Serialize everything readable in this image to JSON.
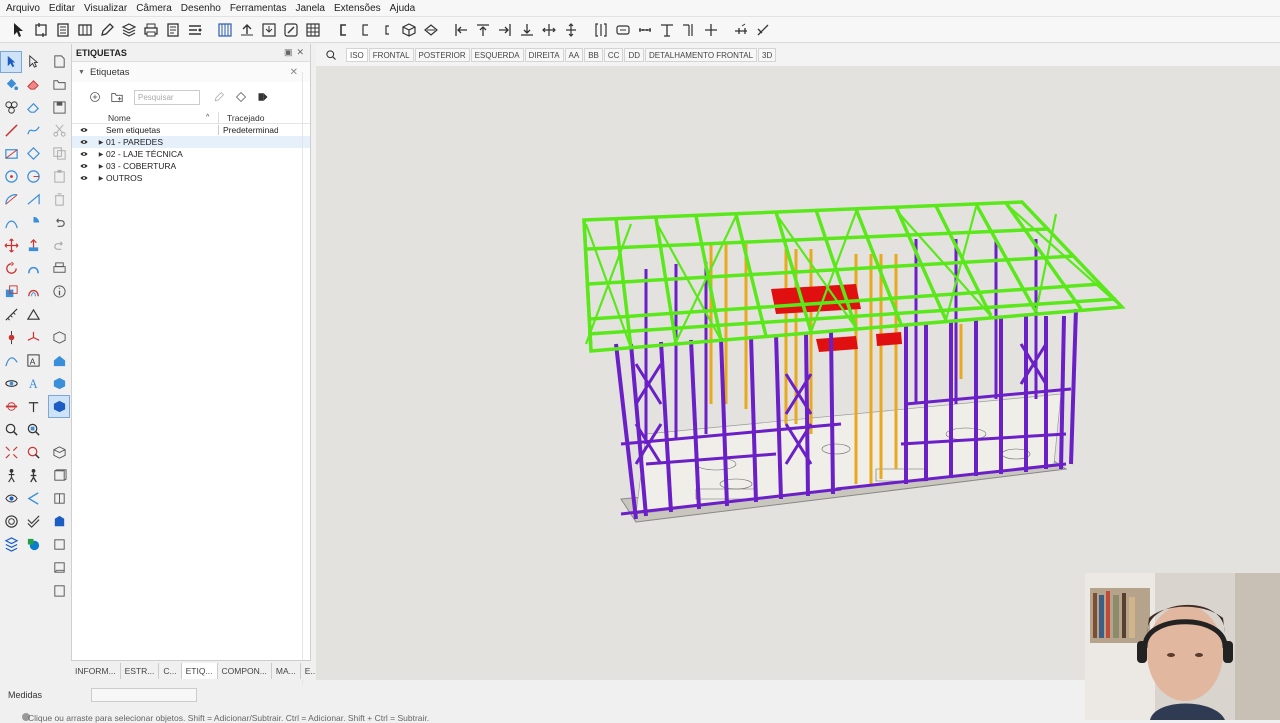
{
  "menu": [
    "Arquivo",
    "Editar",
    "Visualizar",
    "Câmera",
    "Desenho",
    "Ferramentas",
    "Janela",
    "Extensões",
    "Ajuda"
  ],
  "toolbar_icons": [
    "select-icon",
    "component-icon",
    "report-icon",
    "table-icon",
    "edit-icon",
    "layers-icon",
    "print-icon",
    "list-icon",
    "align-icon",
    "columns-icon",
    "upload-icon",
    "pencil-icon",
    "grid-icon",
    "c-profile-icon",
    "c-profile-icon",
    "c-profile-icon",
    "box-icon",
    "paint-icon",
    "align-left-icon",
    "align-top-icon",
    "align-right-icon",
    "align-bottom-icon",
    "center-h-icon",
    "center-v-icon",
    "split-icon",
    "dimension-icon",
    "ruler-icon",
    "stud-icon",
    "connector-icon",
    "cross-icon",
    "beam-icon",
    "angle-icon"
  ],
  "panel": {
    "title": "ETIQUETAS",
    "section": "Etiquetas",
    "search_placeholder": "Pesquisar",
    "columns": {
      "name": "Nome",
      "dash": "Tracejado"
    },
    "rows": [
      {
        "name": "Sem etiquetas",
        "dash": "Predeterminado",
        "expandable": false,
        "highlight": false
      },
      {
        "name": "01 - PAREDES",
        "dash": "",
        "expandable": true,
        "highlight": true
      },
      {
        "name": "02 - LAJE TÉCNICA",
        "dash": "",
        "expandable": true,
        "highlight": false
      },
      {
        "name": "03 - COBERTURA",
        "dash": "",
        "expandable": true,
        "highlight": false
      },
      {
        "name": "OUTROS",
        "dash": "",
        "expandable": true,
        "highlight": false
      }
    ]
  },
  "bottom_tabs": [
    {
      "label": "INFORM...",
      "active": false
    },
    {
      "label": "ESTR...",
      "active": false
    },
    {
      "label": "C...",
      "active": false
    },
    {
      "label": "ETIQ...",
      "active": true
    },
    {
      "label": "COMPON...",
      "active": false
    },
    {
      "label": "MA...",
      "active": false
    },
    {
      "label": "E...",
      "active": false
    }
  ],
  "scene_tabs": [
    {
      "label": "ISO",
      "active": true
    },
    {
      "label": "FRONTAL",
      "active": false
    },
    {
      "label": "POSTERIOR",
      "active": false
    },
    {
      "label": "ESQUERDA",
      "active": false
    },
    {
      "label": "DIREITA",
      "active": false
    },
    {
      "label": "AA",
      "active": false
    },
    {
      "label": "BB",
      "active": false
    },
    {
      "label": "CC",
      "active": false
    },
    {
      "label": "DD",
      "active": false
    },
    {
      "label": "DETALHAMENTO FRONTAL",
      "active": false
    },
    {
      "label": "3D",
      "active": false
    }
  ],
  "status": {
    "measure_label": "Medidas",
    "hint": "Clique ou arraste para selecionar objetos. Shift = Adicionar/Subtrair. Ctrl = Adicionar. Shift + Ctrl = Subtrair."
  },
  "colors": {
    "walls": "#6a1fc7",
    "roof": "#5be81b",
    "slab": "#e8a91c",
    "highlight": "#e01010",
    "viewport_bg": "#e3e2df"
  }
}
